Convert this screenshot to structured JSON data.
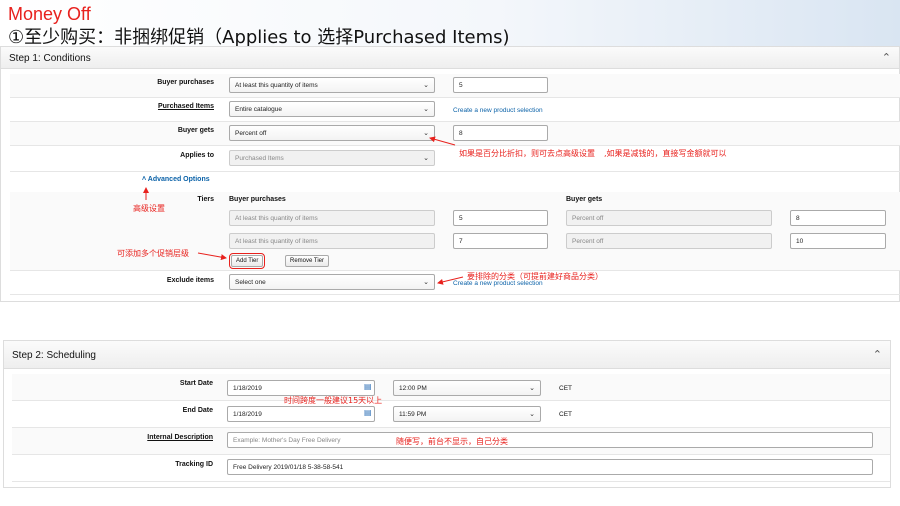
{
  "header": {
    "title": "Money Off",
    "subtitle": "①至少购买：非捆绑促销（Applies to 选择Purchased Items)"
  },
  "step1": {
    "title": "Step 1: Conditions",
    "buyer_purchases": {
      "label": "Buyer purchases",
      "select": "At least this quantity of items",
      "value": "5"
    },
    "purchased_items": {
      "label": "Purchased Items",
      "select": "Entire catalogue",
      "link": "Create a new product selection"
    },
    "buyer_gets": {
      "label": "Buyer gets",
      "select": "Percent off",
      "value": "8"
    },
    "applies_to": {
      "label": "Applies to",
      "select": "Purchased Items"
    },
    "advanced_options": "Advanced Options",
    "tiers": {
      "label": "Tiers",
      "col_purchases": "Buyer purchases",
      "col_gets": "Buyer gets",
      "rows": [
        {
          "purchase_type": "At least this quantity of items",
          "purchase_value": "5",
          "get_type": "Percent off",
          "get_value": "8"
        },
        {
          "purchase_type": "At least this quantity of items",
          "purchase_value": "7",
          "get_type": "Percent off",
          "get_value": "10"
        }
      ],
      "add_tier": "Add Tier",
      "remove_tier": "Remove Tier"
    },
    "exclude_items": {
      "label": "Exclude items",
      "select": "Select one",
      "link": "Create a new product selection"
    }
  },
  "step2": {
    "title": "Step 2: Scheduling",
    "start_date": {
      "label": "Start Date",
      "date": "1/18/2019",
      "time": "12:00 PM",
      "tz": "CET"
    },
    "end_date": {
      "label": "End Date",
      "date": "1/18/2019",
      "time": "11:59 PM",
      "tz": "CET"
    },
    "internal_description": {
      "label": "Internal Description",
      "placeholder": "Example: Mother's Day Free Delivery"
    },
    "tracking_id": {
      "label": "Tracking ID",
      "value": "Free Delivery 2019/01/18 5-38-58-541"
    }
  },
  "annotations": {
    "percent_note": "如果是百分比折扣，则可去点高级设置",
    "money_note": ",如果是减钱的，直接写金额就可以",
    "advanced_note": "高级设置",
    "tiers_note": "可添加多个促销层级",
    "exclude_note": "要排除的分类（可提前建好商品分类）",
    "duration_note": "时间跨度一般建议15天以上",
    "description_note": "随便写，前台不显示，自己分类"
  },
  "colors": {
    "accent_red": "#e8211d",
    "link_blue": "#0b62a8"
  }
}
